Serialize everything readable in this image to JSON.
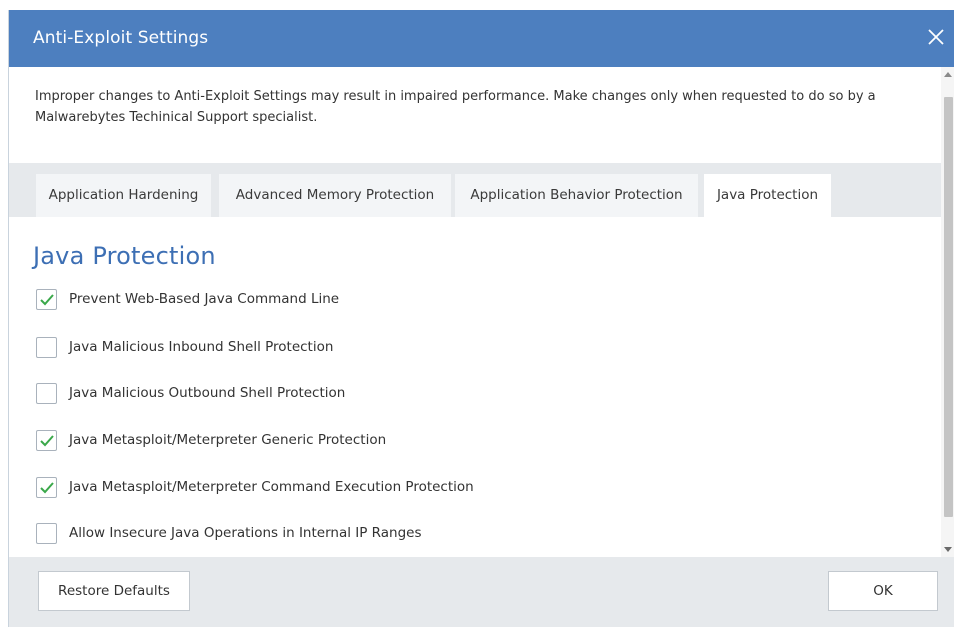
{
  "window": {
    "title": "Anti-Exploit Settings",
    "close_icon": "close-icon"
  },
  "warning_text": "Improper changes to Anti-Exploit Settings may result in impaired performance. Make changes only when requested to do so by a Malwarebytes Techinical Support specialist.",
  "tabs": [
    {
      "label": "Application Hardening",
      "active": false
    },
    {
      "label": "Advanced Memory Protection",
      "active": false
    },
    {
      "label": "Application Behavior Protection",
      "active": false
    },
    {
      "label": "Java Protection",
      "active": true
    }
  ],
  "section": {
    "title": "Java Protection",
    "options": [
      {
        "label": "Prevent Web-Based Java Command Line",
        "checked": true
      },
      {
        "label": "Java Malicious Inbound Shell Protection",
        "checked": false
      },
      {
        "label": "Java Malicious Outbound Shell Protection",
        "checked": false
      },
      {
        "label": "Java Metasploit/Meterpreter Generic Protection",
        "checked": true
      },
      {
        "label": "Java Metasploit/Meterpreter Command Execution Protection",
        "checked": true
      },
      {
        "label": "Allow Insecure Java Operations in Internal IP Ranges",
        "checked": false
      }
    ]
  },
  "footer": {
    "restore_label": "Restore Defaults",
    "ok_label": "OK"
  },
  "colors": {
    "titlebar": "#4d7fbf",
    "section_title": "#3d6fb4",
    "checkmark": "#3aa84a",
    "tabstrip": "#e6e9ec"
  }
}
